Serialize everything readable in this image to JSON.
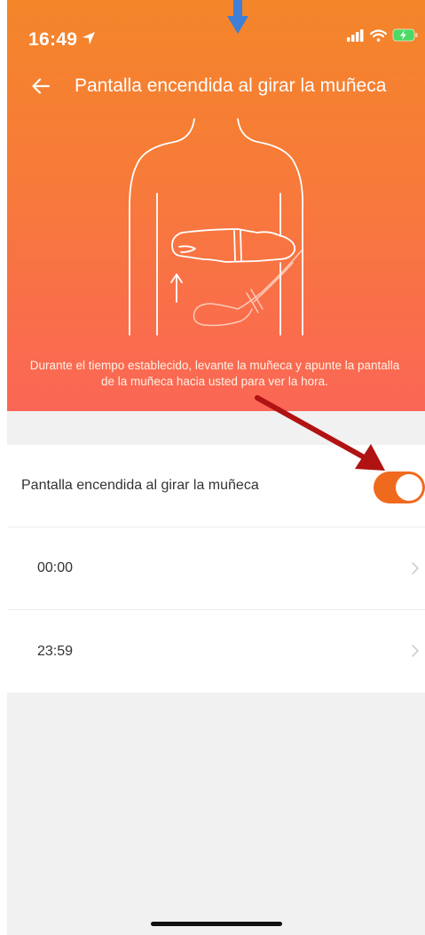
{
  "status_bar": {
    "time": "16:49",
    "icons": [
      "location-arrow-icon",
      "signal-icon",
      "wifi-icon",
      "battery-charging-icon"
    ]
  },
  "nav": {
    "title": "Pantalla encendida al girar la muñeca",
    "back_icon": "back-arrow-icon"
  },
  "hero": {
    "description": "Durante el tiempo establecido, levante la muñeca y apunte la pantalla de la muñeca hacia usted para ver la hora.",
    "illustration": "raise-wrist-illustration"
  },
  "settings": {
    "toggle_row": {
      "label": "Pantalla encendida al girar la muñeca",
      "enabled": true
    },
    "start_time": {
      "value": "00:00"
    },
    "end_time": {
      "value": "23:59"
    }
  },
  "colors": {
    "header_gradient_top": "#f4862a",
    "header_gradient_bottom": "#fb6656",
    "toggle_on": "#f06a1e",
    "annotation_red": "#b11212",
    "annotation_blue": "#3f7fd6"
  }
}
